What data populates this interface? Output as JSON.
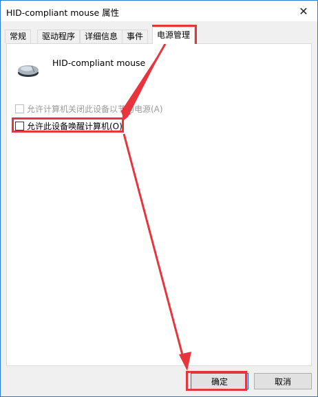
{
  "window": {
    "title": "HID-compliant mouse 属性",
    "close_glyph": "✕"
  },
  "tabs": [
    {
      "label": "常规"
    },
    {
      "label": "驱动程序"
    },
    {
      "label": "详细信息"
    },
    {
      "label": "事件"
    },
    {
      "label": "电源管理",
      "active": true
    }
  ],
  "device": {
    "name": "HID-compliant mouse",
    "icon": "mouse-icon"
  },
  "options": {
    "allow_turn_off": {
      "label": "允许计算机关闭此设备以节约电源(A)",
      "checked": false,
      "enabled": false
    },
    "allow_wake": {
      "label": "允许此设备唤醒计算机(O)",
      "checked": false,
      "enabled": true
    }
  },
  "buttons": {
    "ok": "确定",
    "cancel": "取消"
  },
  "colors": {
    "annotation": "#e8343c",
    "accent": "#0078d7"
  }
}
